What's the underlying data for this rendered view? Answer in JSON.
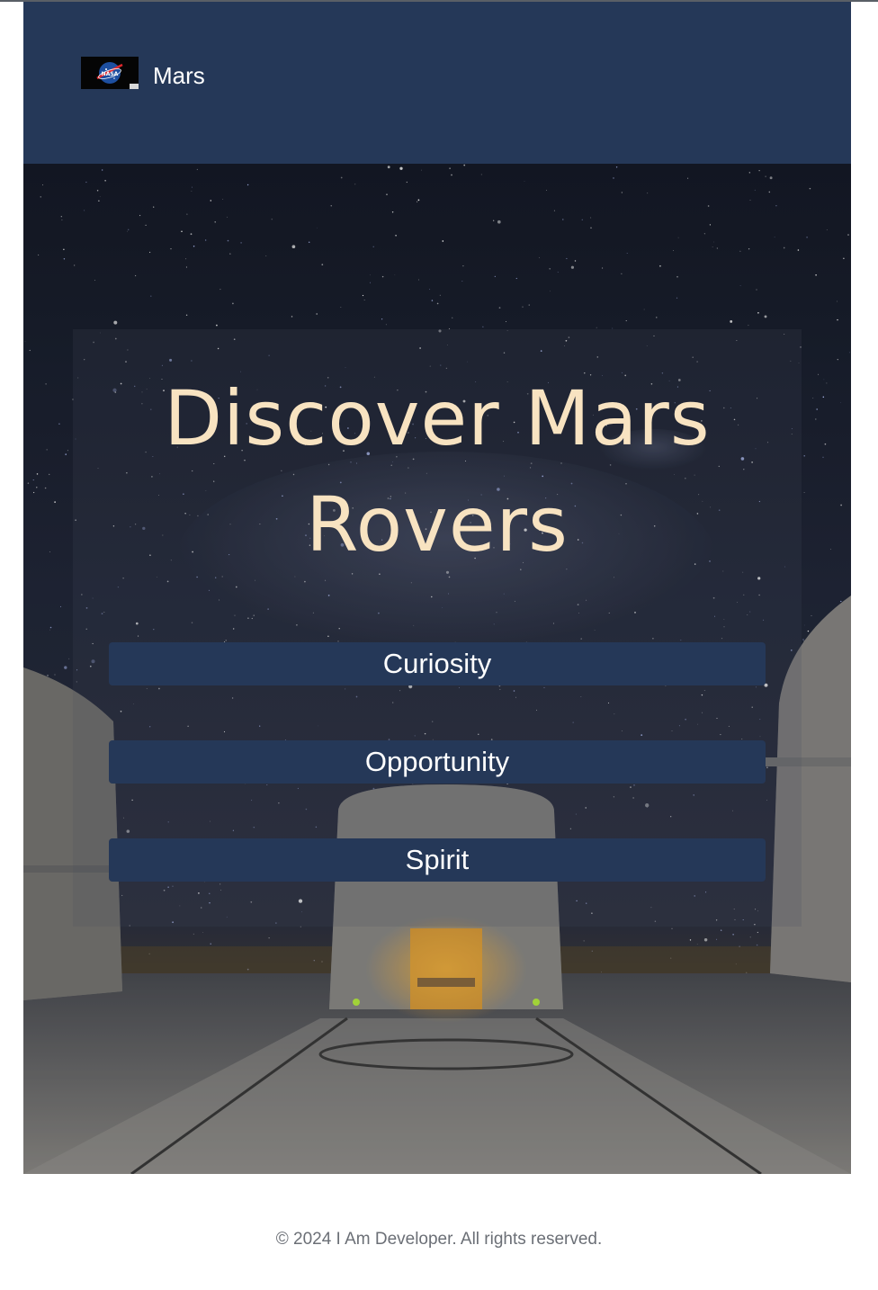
{
  "header": {
    "logo_icon": "nasa-logo-icon",
    "brand": "Mars"
  },
  "hero": {
    "headline_line1": "Discover Mars",
    "headline_line2": "Rovers",
    "background": "night-sky-observatory-image",
    "rovers": [
      {
        "label": "Curiosity"
      },
      {
        "label": "Opportunity"
      },
      {
        "label": "Spirit"
      }
    ]
  },
  "footer": {
    "copyright": "© 2024 I Am Developer. All rights reserved."
  },
  "colors": {
    "header_bg": "#253858",
    "button_bg": "#253858",
    "headline": "#f8e3c1",
    "footer_text": "#6b6f76"
  }
}
